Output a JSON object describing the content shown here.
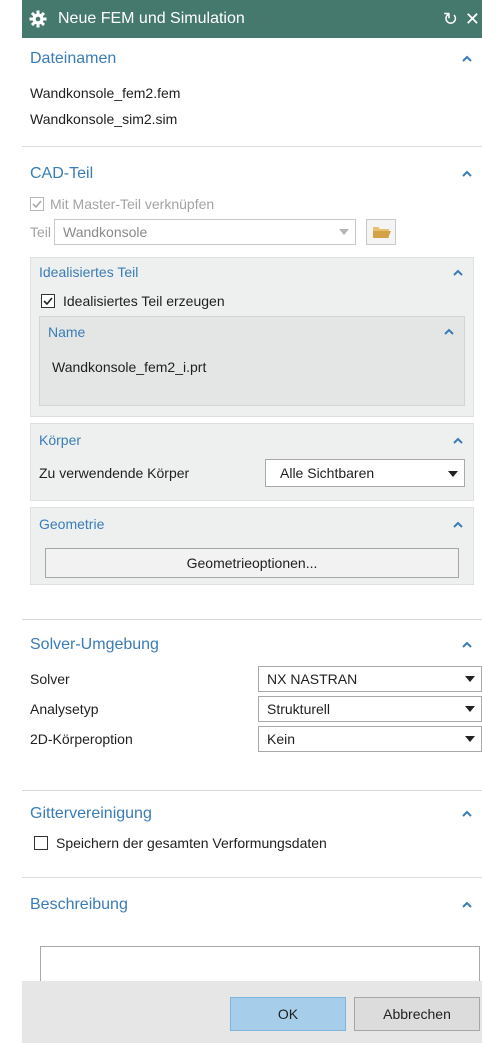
{
  "window": {
    "title": "Neue FEM und Simulation",
    "reset_icon": "↻",
    "close_icon": "✕"
  },
  "dateinamen": {
    "header": "Dateinamen",
    "files": [
      "Wandkonsole_fem2.fem",
      "Wandkonsole_sim2.sim"
    ]
  },
  "cad": {
    "header": "CAD-Teil",
    "master_link_label": "Mit Master-Teil verknüpfen",
    "master_link_checked": true,
    "teil_label": "Teil",
    "teil_value": "Wandkonsole",
    "idealisiert": {
      "header": "Idealisiertes Teil",
      "create_label": "Idealisiertes Teil erzeugen",
      "create_checked": true,
      "name_header": "Name",
      "name_value": "Wandkonsole_fem2_i.prt"
    },
    "koerper": {
      "header": "Körper",
      "label": "Zu verwendende Körper",
      "value": "Alle Sichtbaren"
    },
    "geometrie": {
      "header": "Geometrie",
      "button": "Geometrieoptionen..."
    }
  },
  "solver": {
    "header": "Solver-Umgebung",
    "rows": [
      {
        "label": "Solver",
        "value": "NX NASTRAN"
      },
      {
        "label": "Analysetyp",
        "value": "Strukturell"
      },
      {
        "label": "2D-Körperoption",
        "value": "Kein"
      }
    ]
  },
  "gitter": {
    "header": "Gittervereinigung",
    "save_label": "Speichern der gesamten Verformungsdaten",
    "save_checked": false
  },
  "beschreibung": {
    "header": "Beschreibung",
    "text": ""
  },
  "footer": {
    "ok": "OK",
    "cancel": "Abbrechen"
  },
  "colors": {
    "titlebar": "#46796d",
    "section_header": "#3a7cb8",
    "ok_button": "#a6cdea"
  }
}
